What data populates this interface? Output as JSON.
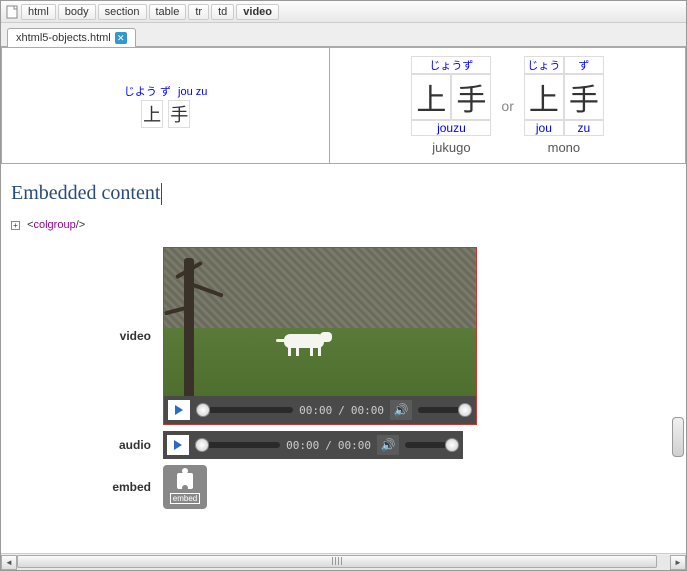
{
  "breadcrumb": [
    "html",
    "body",
    "section",
    "table",
    "tr",
    "td",
    "video"
  ],
  "tab": {
    "label": "xhtml5-objects.html"
  },
  "ruby": {
    "left": {
      "hira": "じよう ず",
      "roma": "jou zu",
      "k1": "上",
      "k2": "手"
    },
    "right_a": {
      "rt1": "じょうず",
      "k1": "上",
      "k2": "手",
      "rom": "jouzu",
      "label": "jukugo"
    },
    "or": "or",
    "right_b": {
      "rt1": "じょう",
      "rt2": "ず",
      "k1": "上",
      "k2": "手",
      "rom1": "jou",
      "rom2": "zu",
      "label": "mono"
    }
  },
  "section_title": "Embedded content",
  "colgroup": {
    "open": "<",
    "name": "colgroup",
    "close": "/>"
  },
  "media": {
    "video_label": "video",
    "audio_label": "audio",
    "embed_label": "embed",
    "time_cur": "00:00",
    "time_sep": "/",
    "time_dur": "00:00",
    "embed_badge": "embed"
  }
}
